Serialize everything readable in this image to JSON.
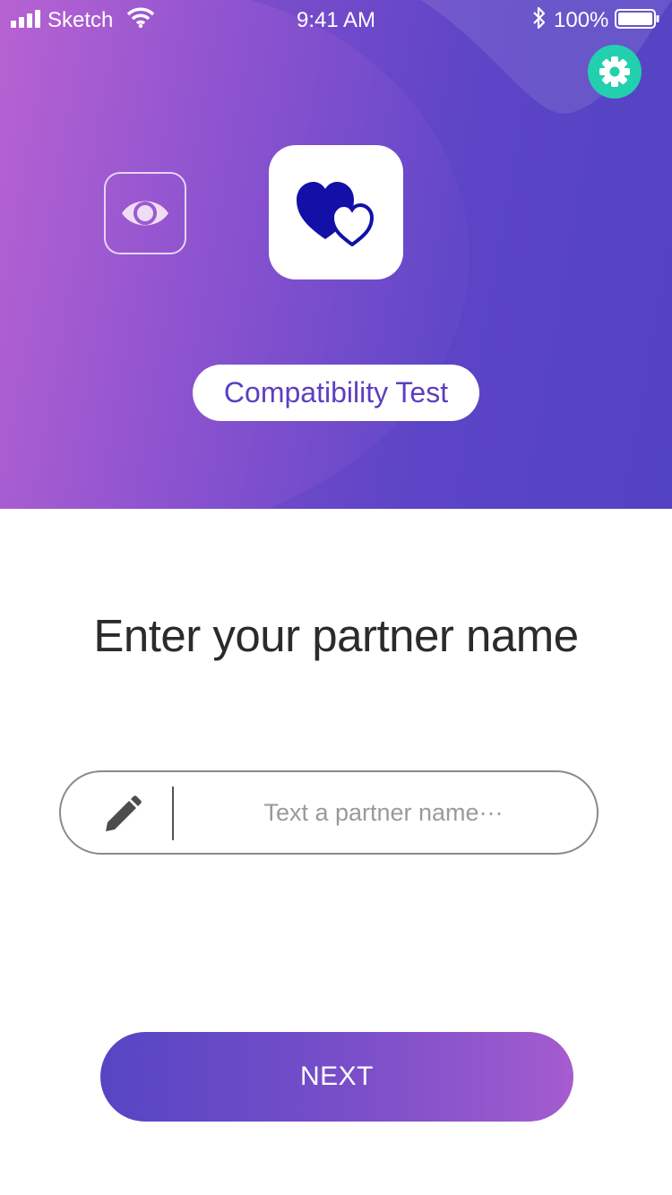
{
  "status_bar": {
    "carrier": "Sketch",
    "time": "9:41 AM",
    "battery": "100%",
    "icons": [
      "signal-icon",
      "wifi-icon",
      "bluetooth-icon",
      "battery-icon"
    ]
  },
  "header": {
    "settings_icon": "gear-icon",
    "eye_icon": "eye-icon",
    "logo_icon": "hearts-icon",
    "title": "Compatibility Test"
  },
  "main": {
    "headline": "Enter your partner name",
    "input": {
      "icon": "pencil-icon",
      "value": "",
      "placeholder": "Text a partner name···"
    },
    "next_label": "NEXT"
  },
  "colors": {
    "gradient_start": "#b762d2",
    "gradient_end": "#5546c5",
    "settings_accent": "#22d0ae",
    "heart_blue": "#1310a8",
    "title_text": "#5a3fc2"
  }
}
